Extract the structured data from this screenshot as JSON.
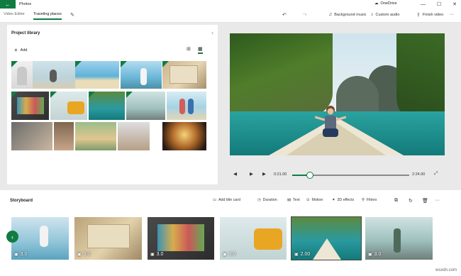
{
  "titlebar": {
    "app_title": "Photos",
    "onedrive_label": "OneDrive",
    "minimize_glyph": "—",
    "maximize_glyph": "☐",
    "close_glyph": "✕"
  },
  "toolbar": {
    "crumb_video_editor": "Video Editor",
    "crumb_project": "Traveling places",
    "background_music": "Background music",
    "custom_audio": "Custom audio",
    "finish_video": "Finish video",
    "more": "···"
  },
  "library": {
    "title": "Project library",
    "add_label": "Add"
  },
  "playback": {
    "current_time": "0:21.00",
    "total_time": "2:24.00",
    "progress": 0.15
  },
  "storyboard": {
    "title": "Storyboard",
    "tools": {
      "add_title_card": "Add title card",
      "duration": "Duration",
      "text": "Text",
      "motion": "Motion",
      "effects_3d": "3D effects",
      "filters": "Filters"
    },
    "clips": [
      {
        "duration": "3.0"
      },
      {
        "duration": "3.0"
      },
      {
        "duration": "3.0"
      },
      {
        "duration": "3.0"
      },
      {
        "duration": "2.00"
      },
      {
        "duration": "3.0"
      }
    ]
  },
  "watermark": "wsxdn.com",
  "colors": {
    "accent": "#107c41"
  }
}
